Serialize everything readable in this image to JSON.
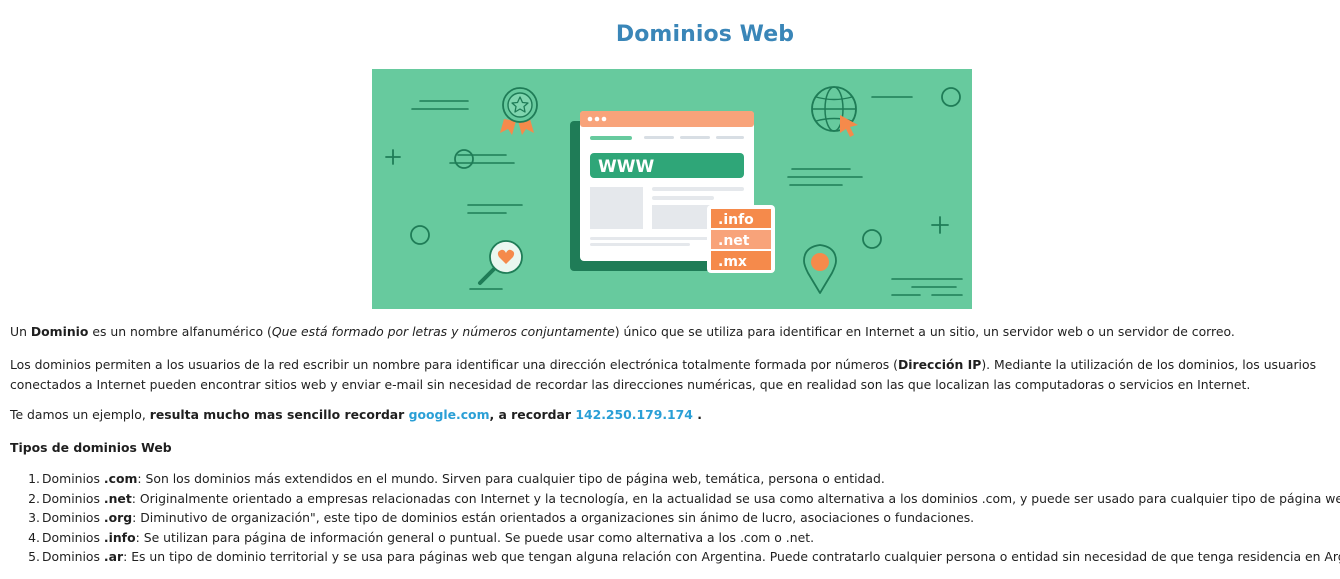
{
  "page": {
    "title": "Dominios Web"
  },
  "hero": {
    "url_bar_text": "WWW",
    "extensions": [
      ".info",
      ".net",
      ".mx"
    ],
    "colors": {
      "background": "#67ca9e",
      "accent": "#f58a4b",
      "dark": "#1f7c57",
      "window": "#ffffff"
    }
  },
  "intro": {
    "p1_a": "Un ",
    "p1_b": "Dominio",
    "p1_c": " es un nombre alfanumérico (",
    "p1_d": "Que está formado por letras y números conjuntamente",
    "p1_e": ") único que se utiliza para identificar en Internet a un sitio, un servidor web o un servidor de correo.",
    "p2_a": "Los dominios permiten a los usuarios de la red escribir un nombre para identificar una dirección electrónica totalmente formada por números (",
    "p2_b": "Dirección IP",
    "p2_c": "). Mediante la utilización de los dominios, los usuarios conectados a Internet pueden encontrar sitios web y enviar e-mail sin necesidad de recordar las direcciones numéricas, que en realidad son las que localizan las computadoras o servicios en Internet.",
    "p3_a": "Te damos un ejemplo, ",
    "p3_b": "resulta mucho mas sencillo recordar ",
    "p3_link1": "google.com",
    "p3_c": ", a recordar ",
    "p3_link2": "142.250.179.174",
    "p3_d": " ."
  },
  "types": {
    "heading": "Tipos de dominios Web",
    "items": [
      {
        "num": "1.",
        "prefix": "Dominios ",
        "ext": ".com",
        "text": ": Son los dominios más extendidos en el mundo. Sirven para cualquier tipo de página web, temática, persona o entidad."
      },
      {
        "num": "2.",
        "prefix": "Dominios ",
        "ext": ".net",
        "text": ": Originalmente orientado a empresas relacionadas con Internet y la tecnología, en la actualidad se usa como alternativa a los dominios .com, y puede ser usado para cualquier tipo de página web."
      },
      {
        "num": "3.",
        "prefix": "Dominios ",
        "ext": ".org",
        "text": ": Diminutivo de organización\", este tipo de dominios están orientados a organizaciones sin ánimo de lucro, asociaciones o fundaciones."
      },
      {
        "num": "4.",
        "prefix": "Dominios ",
        "ext": ".info",
        "text": ": Se utilizan para página de información general o puntual. Se puede usar como alternativa a los .com o .net."
      },
      {
        "num": "5.",
        "prefix": "Dominios ",
        "ext": ".ar",
        "text": ": Es un tipo de dominio territorial y se usa para páginas web que tengan alguna relación con Argentina. Puede contratarlo cualquier persona o entidad sin necesidad de que tenga residencia en Argentina."
      }
    ]
  }
}
